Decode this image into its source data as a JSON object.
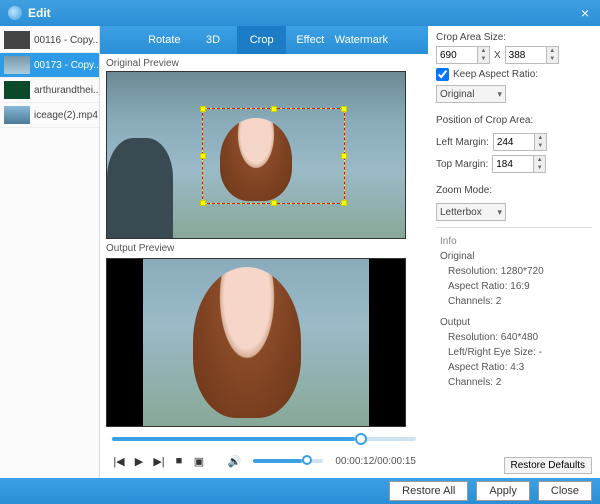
{
  "window": {
    "title": "Edit"
  },
  "sidebar": {
    "items": [
      {
        "label": "00116 - Copy..."
      },
      {
        "label": "00173 - Copy..."
      },
      {
        "label": "arthurandthei..."
      },
      {
        "label": "iceage(2).mp4"
      }
    ],
    "selectedIndex": 1
  },
  "tabs": {
    "items": [
      "Rotate",
      "3D",
      "Crop",
      "Effect",
      "Watermark"
    ],
    "activeIndex": 2
  },
  "previews": {
    "originalLabel": "Original Preview",
    "outputLabel": "Output Preview"
  },
  "crop": {
    "sizeLabel": "Crop Area Size:",
    "width": "690",
    "height": "388",
    "keepAspectLabel": "Keep Aspect Ratio:",
    "aspectOption": "Original",
    "positionLabel": "Position of Crop Area:",
    "leftLabel": "Left Margin:",
    "leftValue": "244",
    "topLabel": "Top Margin:",
    "topValue": "184",
    "zoomLabel": "Zoom Mode:",
    "zoomOption": "Letterbox"
  },
  "info": {
    "heading": "Info",
    "origHeading": "Original",
    "origResolution": "Resolution: 1280*720",
    "origAspect": "Aspect Ratio: 16:9",
    "origChannels": "Channels: 2",
    "outHeading": "Output",
    "outResolution": "Resolution: 640*480",
    "outEye": "Left/Right Eye Size: -",
    "outAspect": "Aspect Ratio: 4:3",
    "outChannels": "Channels: 2"
  },
  "playback": {
    "time": "00:00:12/00:00:15"
  },
  "buttons": {
    "restoreDefaults": "Restore Defaults",
    "restoreAll": "Restore All",
    "apply": "Apply",
    "close": "Close"
  }
}
